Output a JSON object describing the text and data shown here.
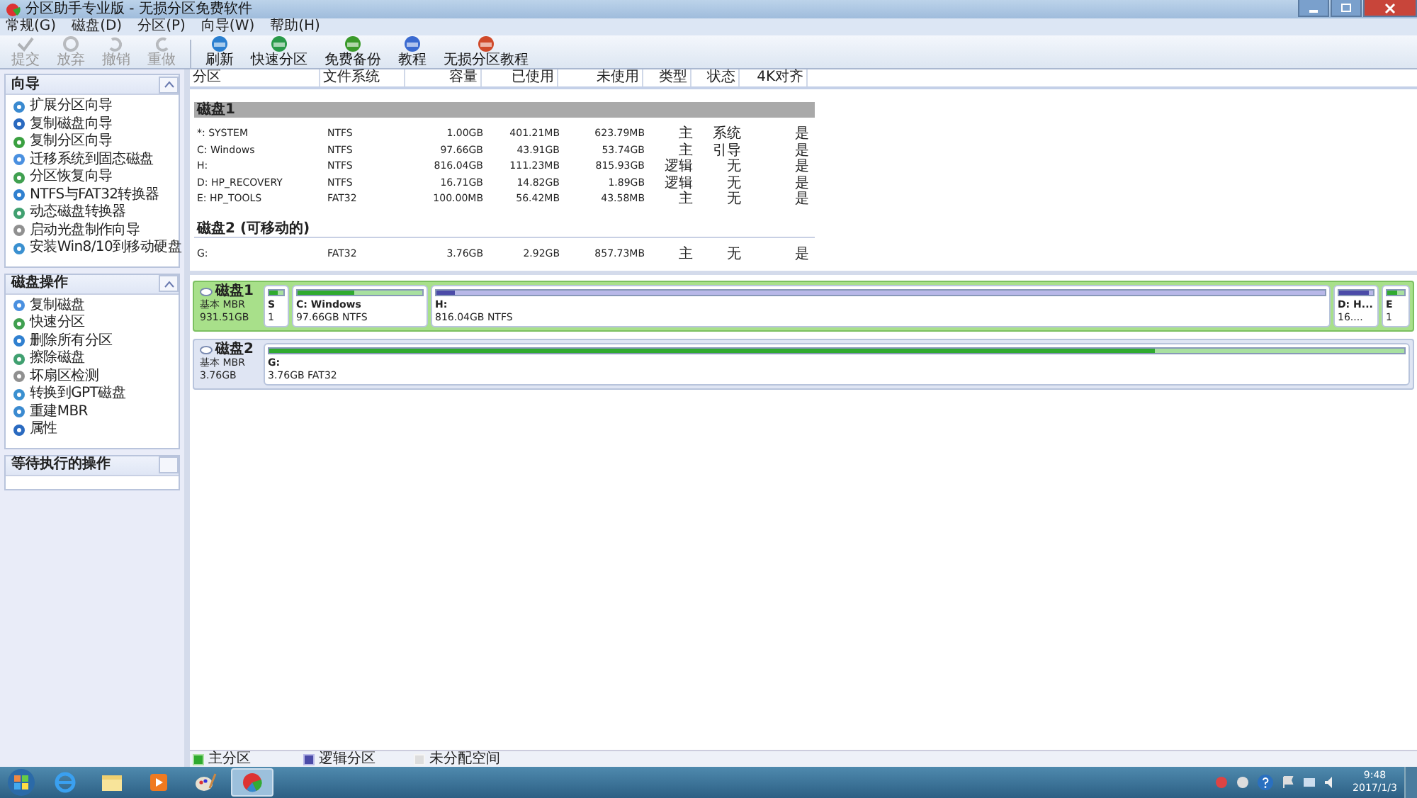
{
  "window": {
    "title": "分区助手专业版 - 无损分区免费软件"
  },
  "menu": [
    "常规(G)",
    "磁盘(D)",
    "分区(P)",
    "向导(W)",
    "帮助(H)"
  ],
  "toolbar": [
    {
      "label": "提交",
      "kind": "commit",
      "disabled": true
    },
    {
      "label": "放弃",
      "kind": "discard",
      "disabled": true
    },
    {
      "label": "撤销",
      "kind": "undo",
      "disabled": true
    },
    {
      "label": "重做",
      "kind": "redo",
      "disabled": true
    },
    {
      "label": "刷新",
      "kind": "refresh",
      "disabled": false
    },
    {
      "label": "快速分区",
      "kind": "quick",
      "disabled": false
    },
    {
      "label": "免费备份",
      "kind": "backup",
      "disabled": false
    },
    {
      "label": "教程",
      "kind": "tutorial",
      "disabled": false
    },
    {
      "label": "无损分区教程",
      "kind": "guide",
      "disabled": false
    }
  ],
  "sidebar": [
    {
      "title": "向导",
      "expanded": true,
      "items": [
        "扩展分区向导",
        "复制磁盘向导",
        "复制分区向导",
        "迁移系统到固态磁盘",
        "分区恢复向导",
        "NTFS与FAT32转换器",
        "动态磁盘转换器",
        "启动光盘制作向导",
        "安装Win8/10到移动硬盘"
      ]
    },
    {
      "title": "磁盘操作",
      "expanded": true,
      "items": [
        "复制磁盘",
        "快速分区",
        "删除所有分区",
        "擦除磁盘",
        "坏扇区检测",
        "转换到GPT磁盘",
        "重建MBR",
        "属性"
      ]
    },
    {
      "title": "等待执行的操作",
      "expanded": false
    }
  ],
  "table": {
    "columns": [
      "分区",
      "文件系统",
      "容量",
      "已使用",
      "未使用",
      "类型",
      "状态",
      "4K对齐"
    ],
    "groups": [
      {
        "title": "磁盘1",
        "rows": [
          [
            "*: SYSTEM",
            "NTFS",
            "1.00GB",
            "401.21MB",
            "623.79MB",
            "主",
            "系统",
            "是"
          ],
          [
            "C: Windows",
            "NTFS",
            "97.66GB",
            "43.91GB",
            "53.74GB",
            "主",
            "引导",
            "是"
          ],
          [
            "H:",
            "NTFS",
            "816.04GB",
            "111.23MB",
            "815.93GB",
            "逻辑",
            "无",
            "是"
          ],
          [
            "D: HP_RECOVERY",
            "NTFS",
            "16.71GB",
            "14.82GB",
            "1.89GB",
            "逻辑",
            "无",
            "是"
          ],
          [
            "E: HP_TOOLS",
            "FAT32",
            "100.00MB",
            "56.42MB",
            "43.58MB",
            "主",
            "无",
            "是"
          ]
        ]
      },
      {
        "title": "磁盘2 (可移动的)",
        "rows": [
          [
            "G:",
            "FAT32",
            "3.76GB",
            "2.92GB",
            "857.73MB",
            "主",
            "无",
            "是"
          ]
        ]
      }
    ]
  },
  "disks": [
    {
      "name": "磁盘1",
      "type": "基本 MBR",
      "size": "931.51GB",
      "selected": true,
      "partitions": [
        {
          "label": "S",
          "detail": "1",
          "kind": "primary",
          "level": 0.6
        },
        {
          "label": "C: Windows",
          "detail": "97.66GB NTFS",
          "kind": "primary",
          "level": 0.45
        },
        {
          "label": "H:",
          "detail": "816.04GB NTFS",
          "kind": "logical",
          "level": 0.02
        },
        {
          "label": "D: H...",
          "detail": "16....",
          "kind": "logical",
          "level": 0.88
        },
        {
          "label": "E",
          "detail": "1",
          "kind": "primary",
          "level": 0.56
        }
      ]
    },
    {
      "name": "磁盘2",
      "type": "基本 MBR",
      "size": "3.76GB",
      "selected": false,
      "partitions": [
        {
          "label": "G:",
          "detail": "3.76GB FAT32",
          "kind": "primary",
          "level": 0.78
        }
      ]
    }
  ],
  "legend": [
    {
      "label": "主分区",
      "kind": "primary"
    },
    {
      "label": "逻辑分区",
      "kind": "logical"
    },
    {
      "label": "未分配空间",
      "kind": "unallocated"
    }
  ],
  "taskbar": {
    "apps": [
      {
        "kind": "ie",
        "selected": false
      },
      {
        "kind": "folder",
        "selected": false
      },
      {
        "kind": "media",
        "selected": false
      },
      {
        "kind": "paint",
        "selected": false
      },
      {
        "kind": "partition",
        "selected": true
      }
    ],
    "time": "9:48",
    "date": "2017/1/3"
  }
}
